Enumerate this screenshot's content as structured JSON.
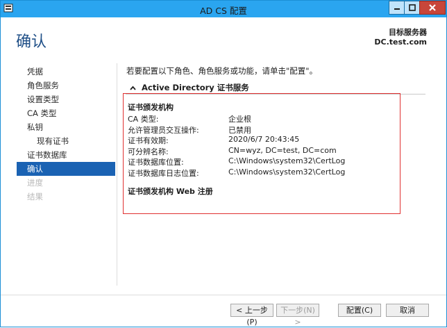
{
  "window": {
    "title": "AD CS 配置"
  },
  "header": {
    "page_title": "确认",
    "target_server_label": "目标服务器",
    "target_server_value": "DC.test.com"
  },
  "nav": {
    "items": [
      {
        "label": "凭据",
        "state": "normal"
      },
      {
        "label": "角色服务",
        "state": "normal"
      },
      {
        "label": "设置类型",
        "state": "normal"
      },
      {
        "label": "CA 类型",
        "state": "normal"
      },
      {
        "label": "私钥",
        "state": "normal"
      },
      {
        "label": "现有证书",
        "state": "sub"
      },
      {
        "label": "证书数据库",
        "state": "normal"
      },
      {
        "label": "确认",
        "state": "active"
      },
      {
        "label": "进度",
        "state": "disabled"
      },
      {
        "label": "结果",
        "state": "disabled"
      }
    ]
  },
  "content": {
    "intro": "若要配置以下角色、角色服务或功能，请单击\"配置\"。",
    "section_title": "Active Directory 证书服务",
    "ca_heading": "证书颁发机构",
    "rows": [
      {
        "key": "CA 类型:",
        "value": "企业根"
      },
      {
        "key": "允许管理员交互操作:",
        "value": "已禁用"
      },
      {
        "key": "证书有效期:",
        "value": "2020/6/7 20:43:45"
      },
      {
        "key": "可分辨名称:",
        "value": "CN=wyz, DC=test, DC=com"
      },
      {
        "key": "证书数据库位置:",
        "value": "C:\\Windows\\system32\\CertLog"
      },
      {
        "key": "证书数据库日志位置:",
        "value": "C:\\Windows\\system32\\CertLog"
      }
    ],
    "web_enrollment_heading": "证书颁发机构 Web 注册"
  },
  "footer": {
    "prev_label": "< 上一步(P)",
    "next_label": "下一步(N) >",
    "configure_label": "配置(C)",
    "cancel_label": "取消"
  },
  "colors": {
    "titlebar": "#2aa5f0",
    "accent_title": "#1f4f87",
    "nav_active": "#1a62b3",
    "highlight_box": "#e03030",
    "close_button": "#c8463a"
  }
}
